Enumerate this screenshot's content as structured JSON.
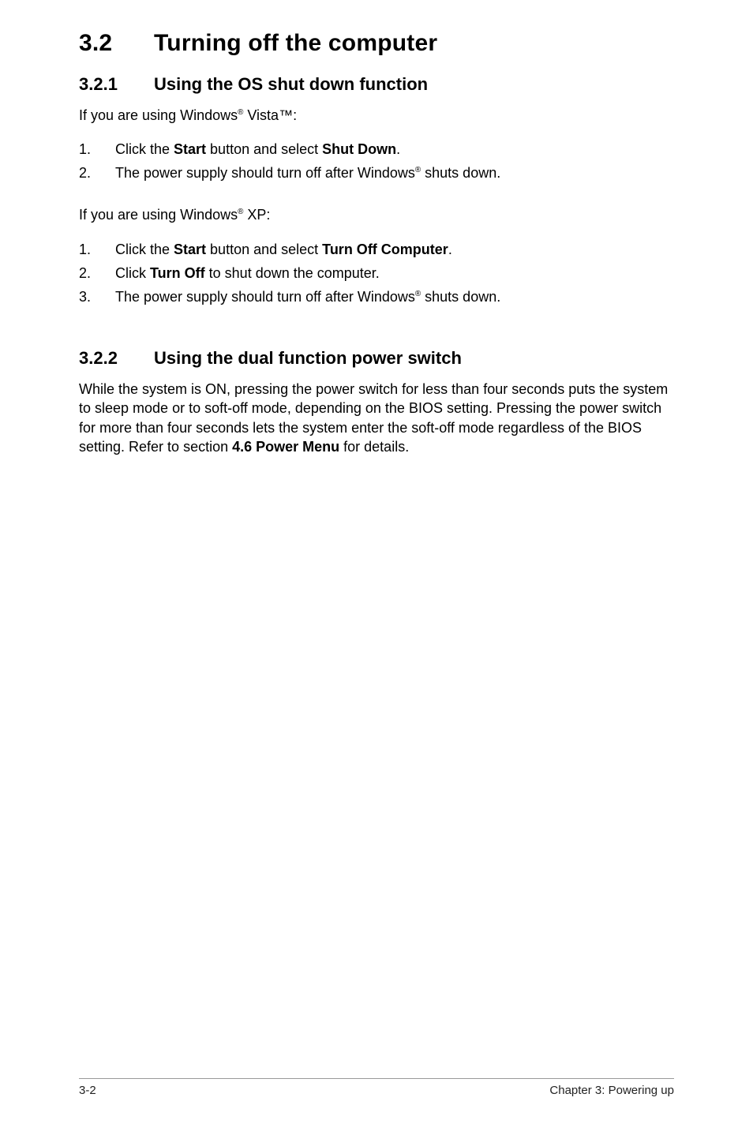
{
  "title": {
    "num": "3.2",
    "text": "Turning off the computer"
  },
  "s321": {
    "num": "3.2.1",
    "heading": "Using the OS shut down function",
    "intro_vista_a": "If you are using Windows",
    "intro_vista_b": " Vista™:",
    "vista_steps": [
      {
        "marker": "1.",
        "pre": "Click the ",
        "b1": "Start",
        "mid": " button and select ",
        "b2": "Shut Down",
        "post": "."
      },
      {
        "marker": "2.",
        "pre": "The power supply should turn off after Windows",
        "sup": "®",
        "post": " shuts down."
      }
    ],
    "intro_xp_a": "If you are using Windows",
    "intro_xp_b": " XP:",
    "xp_steps": [
      {
        "marker": "1.",
        "pre": "Click the ",
        "b1": "Start",
        "mid": " button and select ",
        "b2": "Turn Off Computer",
        "post": "."
      },
      {
        "marker": "2.",
        "pre": "Click ",
        "b1": "Turn Off",
        "post": " to shut down the computer."
      },
      {
        "marker": "3.",
        "pre": "The power supply should turn off after Windows",
        "sup": "®",
        "post": " shuts down."
      }
    ]
  },
  "s322": {
    "num": "3.2.2",
    "heading": "Using the dual function power switch",
    "body_a": "While the system is ON, pressing the power switch for less than four seconds puts the system to sleep mode or to soft-off mode, depending on the BIOS setting. Pressing the power switch for more than four seconds lets the system enter the soft-off mode regardless of the BIOS setting. Refer to section ",
    "body_b": "4.6 Power Menu",
    "body_c": " for details."
  },
  "footer": {
    "left": "3-2",
    "right": "Chapter 3: Powering up"
  },
  "reg": "®"
}
